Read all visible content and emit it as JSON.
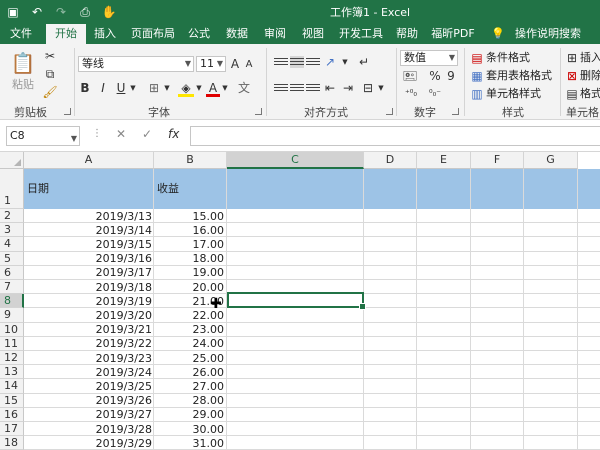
{
  "window": {
    "title": "工作簿1 - Excel"
  },
  "tabs": [
    "文件",
    "开始",
    "插入",
    "页面布局",
    "公式",
    "数据",
    "审阅",
    "视图",
    "开发工具",
    "帮助",
    "福昕PDF",
    "操作说明搜索"
  ],
  "ribbon": {
    "clipboard": {
      "paste": "粘贴",
      "label": "剪贴板"
    },
    "font": {
      "name": "等线",
      "size": "11",
      "label": "字体",
      "bold": "B",
      "italic": "I",
      "underline": "U",
      "grow": "A",
      "shrink": "A",
      "color_a": "A",
      "highlight_a": "A"
    },
    "alignment": {
      "label": "对齐方式"
    },
    "number": {
      "format": "数值",
      "label": "数字",
      "percent": "%",
      "comma": "9"
    },
    "styles": {
      "conditional": "条件格式",
      "table": "套用表格格式",
      "cell": "单元格样式",
      "label": "样式"
    },
    "cells": {
      "insert": "插入",
      "delete": "删除",
      "format": "格式",
      "label": "单元格"
    }
  },
  "formula_bar": {
    "name_box": "C8",
    "fx": "fx",
    "cancel": "✕",
    "enter": "✓",
    "value": ""
  },
  "sheet": {
    "columns": [
      "A",
      "B",
      "C",
      "D",
      "E",
      "F",
      "G"
    ],
    "header_row": {
      "row": "1",
      "a": "日期",
      "b": "收益"
    },
    "rows": [
      {
        "row": "2",
        "date": "2019/3/13",
        "value": "15.00"
      },
      {
        "row": "3",
        "date": "2019/3/14",
        "value": "16.00"
      },
      {
        "row": "4",
        "date": "2019/3/15",
        "value": "17.00"
      },
      {
        "row": "5",
        "date": "2019/3/16",
        "value": "18.00"
      },
      {
        "row": "6",
        "date": "2019/3/17",
        "value": "19.00"
      },
      {
        "row": "7",
        "date": "2019/3/18",
        "value": "20.00"
      },
      {
        "row": "8",
        "date": "2019/3/19",
        "value": "21.00"
      },
      {
        "row": "9",
        "date": "2019/3/20",
        "value": "22.00"
      },
      {
        "row": "10",
        "date": "2019/3/21",
        "value": "23.00"
      },
      {
        "row": "11",
        "date": "2019/3/22",
        "value": "24.00"
      },
      {
        "row": "12",
        "date": "2019/3/23",
        "value": "25.00"
      },
      {
        "row": "13",
        "date": "2019/3/24",
        "value": "26.00"
      },
      {
        "row": "14",
        "date": "2019/3/25",
        "value": "27.00"
      },
      {
        "row": "15",
        "date": "2019/3/26",
        "value": "28.00"
      },
      {
        "row": "16",
        "date": "2019/3/27",
        "value": "29.00"
      },
      {
        "row": "17",
        "date": "2019/3/28",
        "value": "30.00"
      },
      {
        "row": "18",
        "date": "2019/3/29",
        "value": "31.00"
      }
    ],
    "selected_cell": "C8"
  },
  "colors": {
    "accent": "#217346",
    "header_fill": "#9dc3e6"
  }
}
